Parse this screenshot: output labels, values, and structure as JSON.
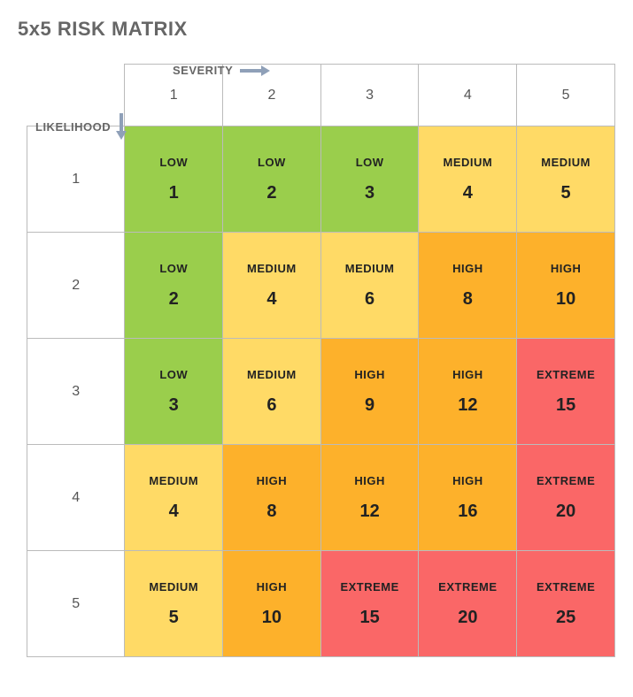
{
  "title": "5x5 RISK MATRIX",
  "axes": {
    "severity_label": "SEVERITY",
    "likelihood_label": "LIKELIHOOD",
    "severity_headers": [
      "1",
      "2",
      "3",
      "4",
      "5"
    ],
    "likelihood_headers": [
      "1",
      "2",
      "3",
      "4",
      "5"
    ]
  },
  "risk_levels": {
    "low": "LOW",
    "medium": "MEDIUM",
    "high": "HIGH",
    "extreme": "EXTREME"
  },
  "colors": {
    "low": "#9ace4c",
    "medium": "#ffda66",
    "high": "#fdb12b",
    "extreme": "#fa6767"
  },
  "cells": [
    [
      {
        "level": "low",
        "score": "1"
      },
      {
        "level": "low",
        "score": "2"
      },
      {
        "level": "low",
        "score": "3"
      },
      {
        "level": "medium",
        "score": "4"
      },
      {
        "level": "medium",
        "score": "5"
      }
    ],
    [
      {
        "level": "low",
        "score": "2"
      },
      {
        "level": "medium",
        "score": "4"
      },
      {
        "level": "medium",
        "score": "6"
      },
      {
        "level": "high",
        "score": "8"
      },
      {
        "level": "high",
        "score": "10"
      }
    ],
    [
      {
        "level": "low",
        "score": "3"
      },
      {
        "level": "medium",
        "score": "6"
      },
      {
        "level": "high",
        "score": "9"
      },
      {
        "level": "high",
        "score": "12"
      },
      {
        "level": "extreme",
        "score": "15"
      }
    ],
    [
      {
        "level": "medium",
        "score": "4"
      },
      {
        "level": "high",
        "score": "8"
      },
      {
        "level": "high",
        "score": "12"
      },
      {
        "level": "high",
        "score": "16"
      },
      {
        "level": "extreme",
        "score": "20"
      }
    ],
    [
      {
        "level": "medium",
        "score": "5"
      },
      {
        "level": "high",
        "score": "10"
      },
      {
        "level": "extreme",
        "score": "15"
      },
      {
        "level": "extreme",
        "score": "20"
      },
      {
        "level": "extreme",
        "score": "25"
      }
    ]
  ],
  "chart_data": {
    "type": "heatmap",
    "title": "5x5 RISK MATRIX",
    "xlabel": "SEVERITY",
    "ylabel": "LIKELIHOOD",
    "x_categories": [
      1,
      2,
      3,
      4,
      5
    ],
    "y_categories": [
      1,
      2,
      3,
      4,
      5
    ],
    "values": [
      [
        1,
        2,
        3,
        4,
        5
      ],
      [
        2,
        4,
        6,
        8,
        10
      ],
      [
        3,
        6,
        9,
        12,
        15
      ],
      [
        4,
        8,
        12,
        16,
        20
      ],
      [
        5,
        10,
        15,
        20,
        25
      ]
    ],
    "levels": [
      [
        "LOW",
        "LOW",
        "LOW",
        "MEDIUM",
        "MEDIUM"
      ],
      [
        "LOW",
        "MEDIUM",
        "MEDIUM",
        "HIGH",
        "HIGH"
      ],
      [
        "LOW",
        "MEDIUM",
        "HIGH",
        "HIGH",
        "EXTREME"
      ],
      [
        "MEDIUM",
        "HIGH",
        "HIGH",
        "HIGH",
        "EXTREME"
      ],
      [
        "MEDIUM",
        "HIGH",
        "EXTREME",
        "EXTREME",
        "EXTREME"
      ]
    ],
    "level_colors": {
      "LOW": "#9ace4c",
      "MEDIUM": "#ffda66",
      "HIGH": "#fdb12b",
      "EXTREME": "#fa6767"
    }
  }
}
